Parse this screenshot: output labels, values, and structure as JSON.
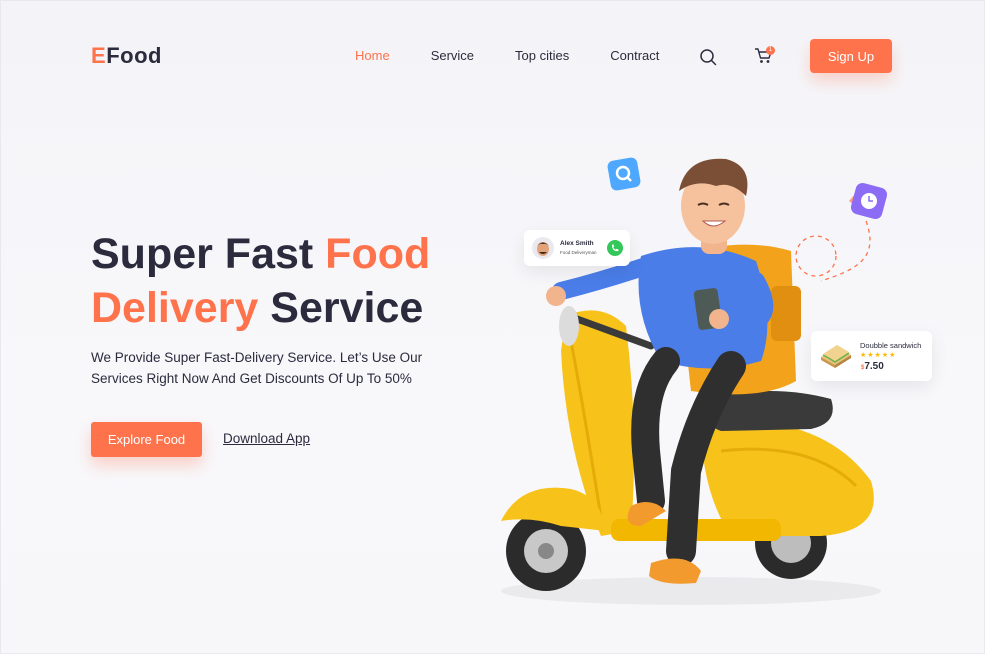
{
  "brand": {
    "first_letter": "E",
    "rest": "Food"
  },
  "nav": {
    "items": [
      {
        "label": "Home",
        "active": true
      },
      {
        "label": "Service",
        "active": false
      },
      {
        "label": "Top cities",
        "active": false
      },
      {
        "label": "Contract",
        "active": false
      }
    ],
    "cart_count": "1",
    "signup_label": "Sign Up"
  },
  "hero": {
    "headline_part1": "Super Fast ",
    "headline_accent1": "Food",
    "headline_accent2": "Delivery",
    "headline_part2": " Service",
    "subtitle": "We Provide Super Fast-Delivery Service. Let’s Use Our Services Right Now And Get Discounts Of Up To 50%",
    "explore_label": "Explore Food",
    "download_label": "Download App"
  },
  "cards": {
    "driver": {
      "name": "Alex Smith",
      "role": "Food Deliveryman"
    },
    "food": {
      "name": "Doubble sandwich",
      "rating_stars": "★★★★★",
      "currency": "$",
      "price": "7.50"
    }
  },
  "colors": {
    "accent": "#fe724c",
    "dark": "#2b2b3d",
    "scooter": "#f7c31a",
    "shirt": "#4a7de8"
  },
  "icons": [
    "search-icon",
    "cart-icon",
    "phone-icon",
    "clock-icon",
    "magnifier-badge-icon"
  ]
}
